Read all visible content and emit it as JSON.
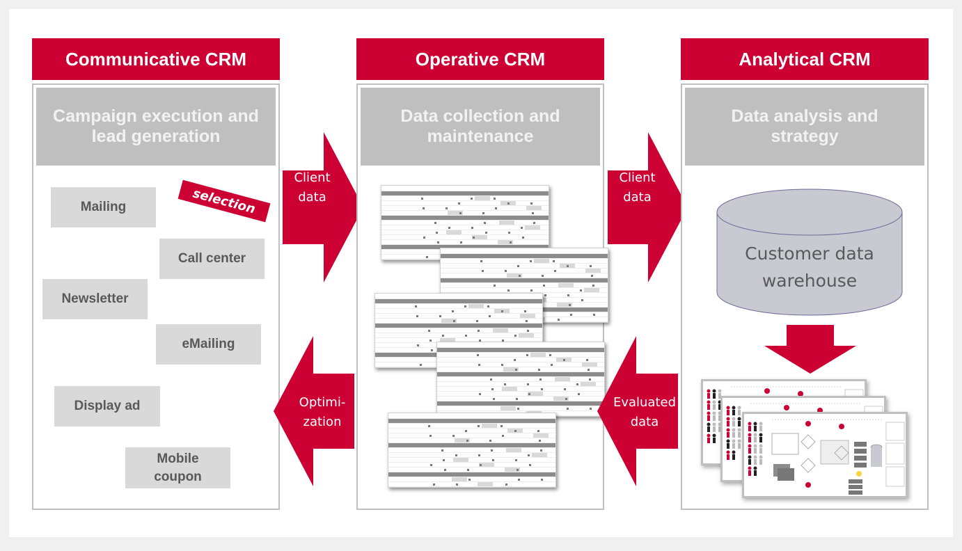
{
  "columns": [
    {
      "title": "Communicative CRM",
      "subtitle_lines": [
        "Campaign execution  and",
        "lead generation"
      ],
      "channels": [
        "Mailing",
        "Call center",
        "Newsletter",
        "eMailing",
        "Display ad",
        "Mobile coupon"
      ],
      "tag": "selection"
    },
    {
      "title": "Operative CRM",
      "subtitle_lines": [
        "Data collection and",
        "maintenance"
      ]
    },
    {
      "title": "Analytical CRM",
      "subtitle_lines": [
        "Data analysis and",
        "strategy"
      ],
      "warehouse_lines": [
        "Customer data",
        "warehouse"
      ]
    }
  ],
  "arrows": [
    {
      "direction": "right",
      "lines": [
        "Client",
        "data"
      ]
    },
    {
      "direction": "left",
      "lines": [
        "Optimi-",
        "zation"
      ]
    },
    {
      "direction": "right",
      "lines": [
        "Client",
        "data"
      ]
    },
    {
      "direction": "left",
      "lines": [
        "Evaluated",
        "data"
      ]
    }
  ],
  "colors": {
    "accent": "#cc0033",
    "subheader_bg": "#bfbfbf",
    "channel_bg": "#d9d9d9",
    "channel_text": "#595959",
    "warehouse_fill": "#c9c9d1"
  }
}
